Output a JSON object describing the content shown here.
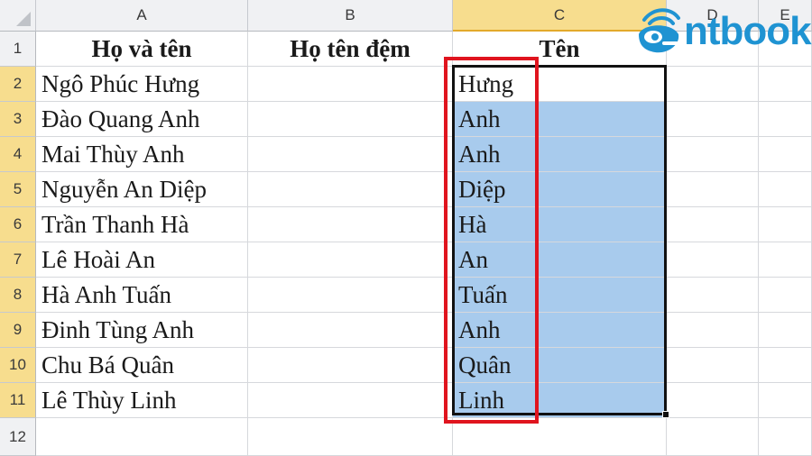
{
  "columns": [
    "A",
    "B",
    "C",
    "D",
    "E"
  ],
  "rows": [
    "1",
    "2",
    "3",
    "4",
    "5",
    "6",
    "7",
    "8",
    "9",
    "10",
    "11",
    "12"
  ],
  "header_row": {
    "a": "Họ và tên",
    "b": "Họ tên đệm",
    "c": "Tên"
  },
  "data_rows": [
    {
      "a": "Ngô Phúc Hưng",
      "c": "Hưng"
    },
    {
      "a": "Đào Quang Anh",
      "c": "Anh"
    },
    {
      "a": "Mai Thùy Anh",
      "c": "Anh"
    },
    {
      "a": "Nguyễn An Diệp",
      "c": "Diệp"
    },
    {
      "a": "Trần Thanh Hà",
      "c": "Hà"
    },
    {
      "a": "Lê Hoài An",
      "c": "An"
    },
    {
      "a": "Hà Anh Tuấn",
      "c": "Tuấn"
    },
    {
      "a": "Đinh Tùng Anh",
      "c": "Anh"
    },
    {
      "a": "Chu Bá Quân",
      "c": "Quân"
    },
    {
      "a": "Lê Thùy Linh",
      "c": "Linh"
    }
  ],
  "logo": {
    "text": "ntbook"
  },
  "colors": {
    "selection_fill": "#a8cbed",
    "highlight_border": "#e0141e",
    "brand": "#1f93d2",
    "header_selected": "#f7dd8e"
  }
}
